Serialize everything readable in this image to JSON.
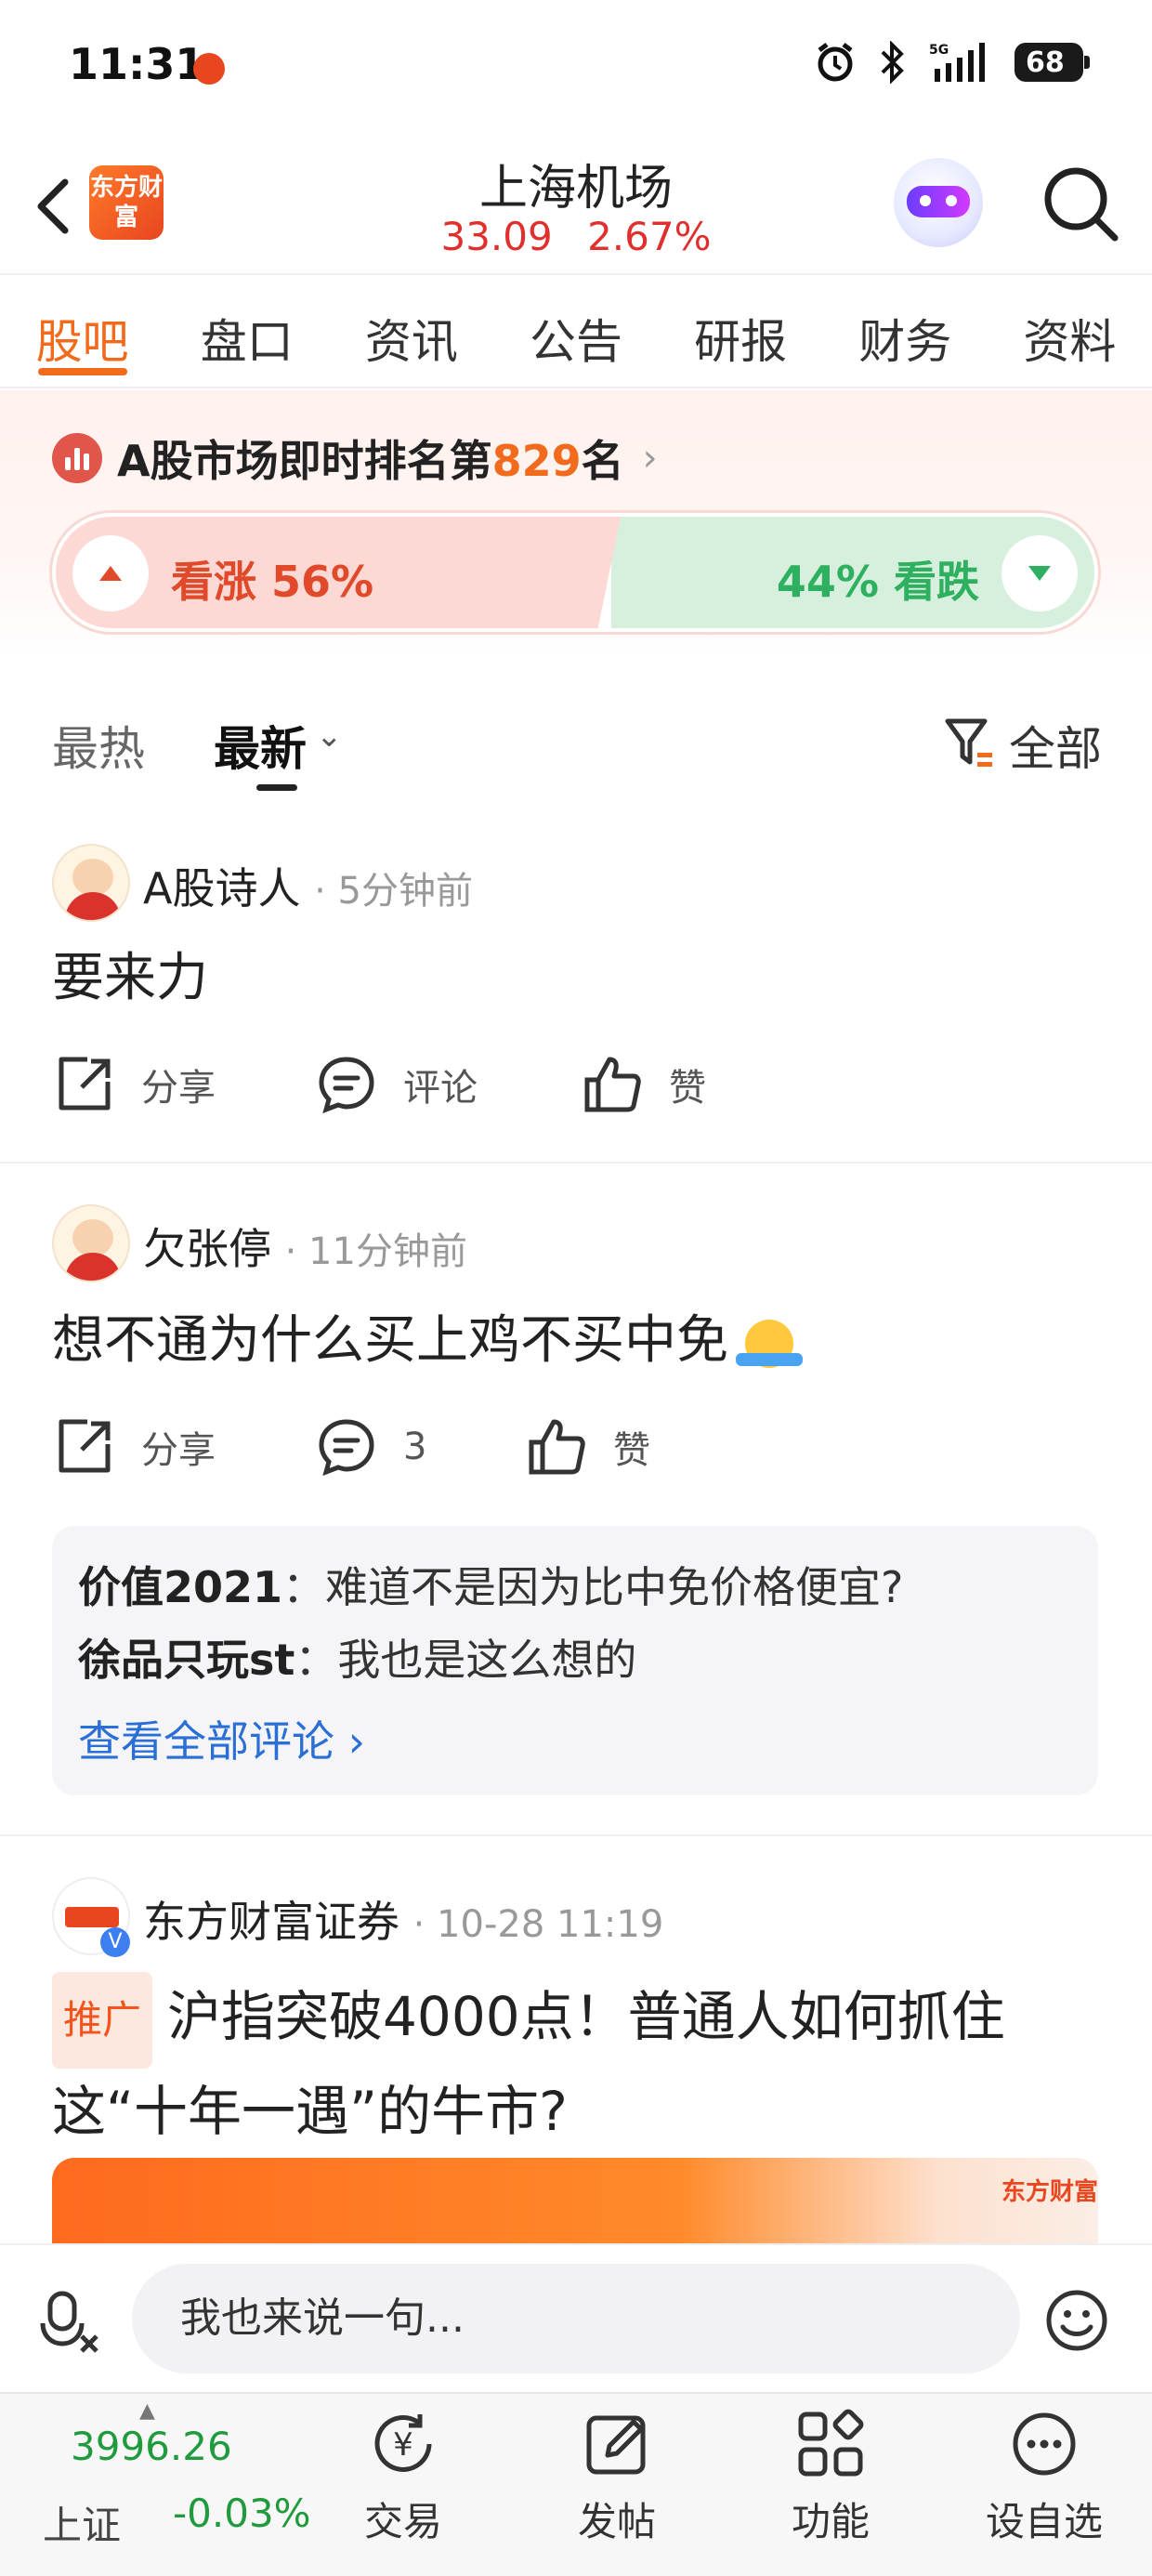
{
  "status_bar": {
    "time": "11:31",
    "battery": "68",
    "network": "5G"
  },
  "header": {
    "app_logo_text": "东方财富",
    "stock_name": "上海机场",
    "price": "33.09",
    "change_pct": "2.67%"
  },
  "tabs": [
    {
      "label": "股吧",
      "active": true
    },
    {
      "label": "盘口"
    },
    {
      "label": "资讯"
    },
    {
      "label": "公告"
    },
    {
      "label": "研报"
    },
    {
      "label": "财务"
    },
    {
      "label": "资料"
    }
  ],
  "sentiment": {
    "rank_prefix": "A股市场即时排名第",
    "rank_number": "829",
    "rank_suffix": "名",
    "up_label": "看涨 56%",
    "down_label": "44% 看跌",
    "up_share": 0.56,
    "colors": {
      "up": "#e04a2a",
      "down": "#2fb061"
    }
  },
  "sort": {
    "hot": "最热",
    "new": "最新",
    "filter": "全部"
  },
  "posts": [
    {
      "user": "A股诗人",
      "time": "· 5分钟前",
      "body": "要来力",
      "share": "分享",
      "comment": "评论",
      "like": "赞"
    },
    {
      "user": "欠张停",
      "time": "· 11分钟前",
      "body": "想不通为什么买上鸡不买中免",
      "share": "分享",
      "comment": "3",
      "like": "赞",
      "comments": [
        {
          "user": "价值2021",
          "text": "：难道不是因为比中免价格便宜?"
        },
        {
          "user": "徐品只玩st",
          "text": "：我也是这么想的"
        }
      ],
      "view_all": "查看全部评论 ›"
    }
  ],
  "ad": {
    "user": "东方财富证券",
    "time": "· 10-28 11:19",
    "tag": "推广",
    "title": "沪指突破4000点！普通人如何抓住这“十年一遇”的牛市?",
    "banner_logo": "东方财富"
  },
  "input": {
    "placeholder": "我也来说一句..."
  },
  "bottom_nav": {
    "index_value": "3996.26",
    "index_name": "上证",
    "index_change": "-0.03%",
    "items": [
      "交易",
      "发帖",
      "功能",
      "设自选"
    ]
  }
}
